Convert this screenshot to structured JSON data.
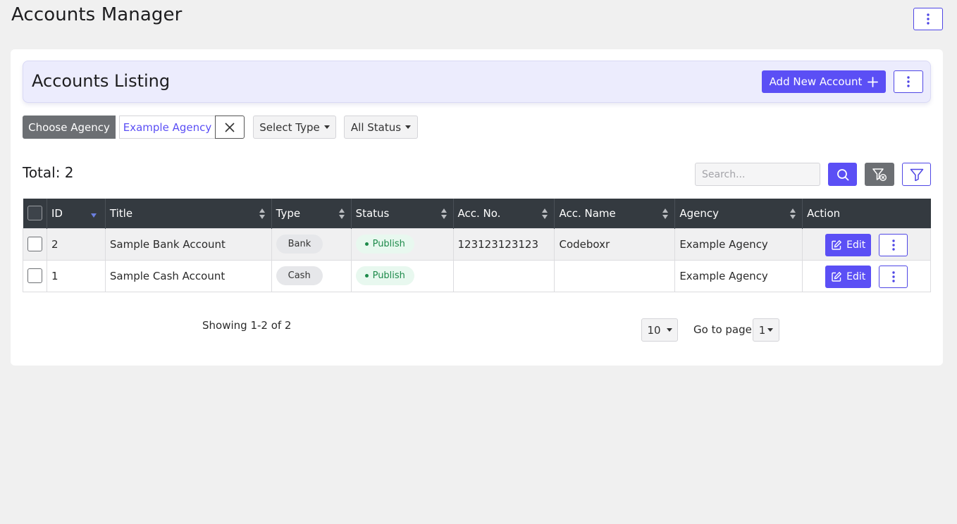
{
  "page": {
    "title": "Accounts Manager",
    "menu_icon": "kebab-vertical-icon"
  },
  "listing": {
    "title": "Accounts Listing",
    "add_button_label": "Add New Account",
    "add_icon": "plus-icon",
    "menu_icon": "kebab-vertical-icon"
  },
  "filters": {
    "choose_agency_label": "Choose Agency",
    "agency_value": "Example Agency",
    "clear_icon": "close-icon",
    "type_select": "Select Type",
    "status_select": "All Status"
  },
  "summary": {
    "total_label": "Total: 2"
  },
  "search": {
    "placeholder": "Search...",
    "search_icon": "search-icon",
    "clear_filter_icon": "filter-clear-icon",
    "filter_icon": "filter-icon"
  },
  "colors": {
    "accent": "#5b4ff5",
    "header_bg": "#343a40",
    "publish_bg": "#e8f8ef",
    "publish_text": "#1d8a4a"
  },
  "table": {
    "columns": [
      "ID",
      "Title",
      "Type",
      "Status",
      "Acc. No.",
      "Acc. Name",
      "Agency",
      "Action"
    ],
    "rows": [
      {
        "id": "2",
        "title": "Sample Bank Account",
        "type": "Bank",
        "status": "Publish",
        "acc_no": "123123123123",
        "acc_name": "Codeboxr",
        "agency": "Example Agency",
        "edit_label": "Edit"
      },
      {
        "id": "1",
        "title": "Sample Cash Account",
        "type": "Cash",
        "status": "Publish",
        "acc_no": "",
        "acc_name": "",
        "agency": "Example Agency",
        "edit_label": "Edit"
      }
    ]
  },
  "pagination": {
    "showing": "Showing 1-2 of 2",
    "per_page": "10",
    "goto_label": "Go to page",
    "current_page": "1"
  }
}
